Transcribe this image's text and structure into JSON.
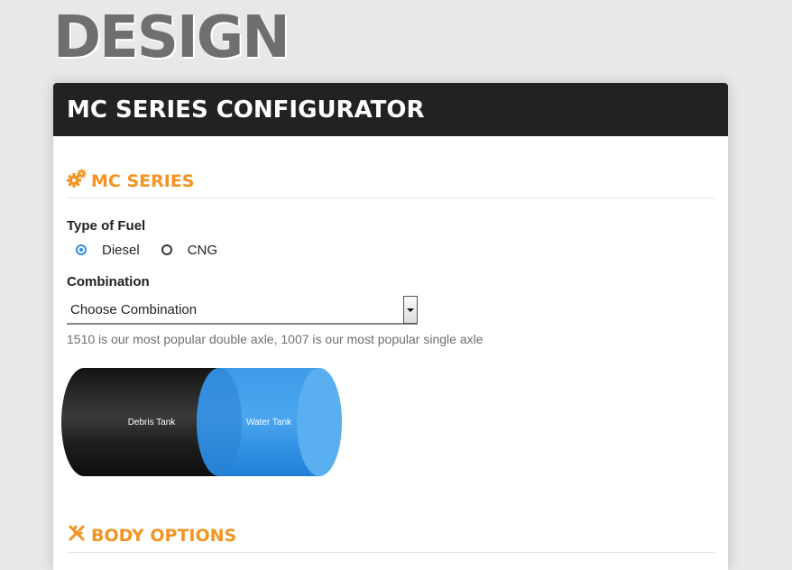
{
  "page": {
    "title": "DESIGN"
  },
  "card": {
    "title": "MC SERIES CONFIGURATOR"
  },
  "sections": {
    "mc_series": {
      "title": "MC SERIES",
      "icon": "gears-icon",
      "color": "#f39322"
    },
    "body_options": {
      "title": "BODY OPTIONS",
      "icon": "wrench-icon",
      "color": "#f39322"
    }
  },
  "fuel": {
    "label": "Type of Fuel",
    "options": [
      {
        "label": "Diesel",
        "selected": true
      },
      {
        "label": "CNG",
        "selected": false
      }
    ]
  },
  "combination": {
    "label": "Combination",
    "value": "Choose Combination",
    "hint": "1510 is our most popular double axle, 1007 is our most popular single axle"
  },
  "tank": {
    "debris_label": "Debris Tank",
    "water_label": "Water Tank",
    "debris_color": "#1f1f1f",
    "water_color": "#2f8ce0"
  }
}
